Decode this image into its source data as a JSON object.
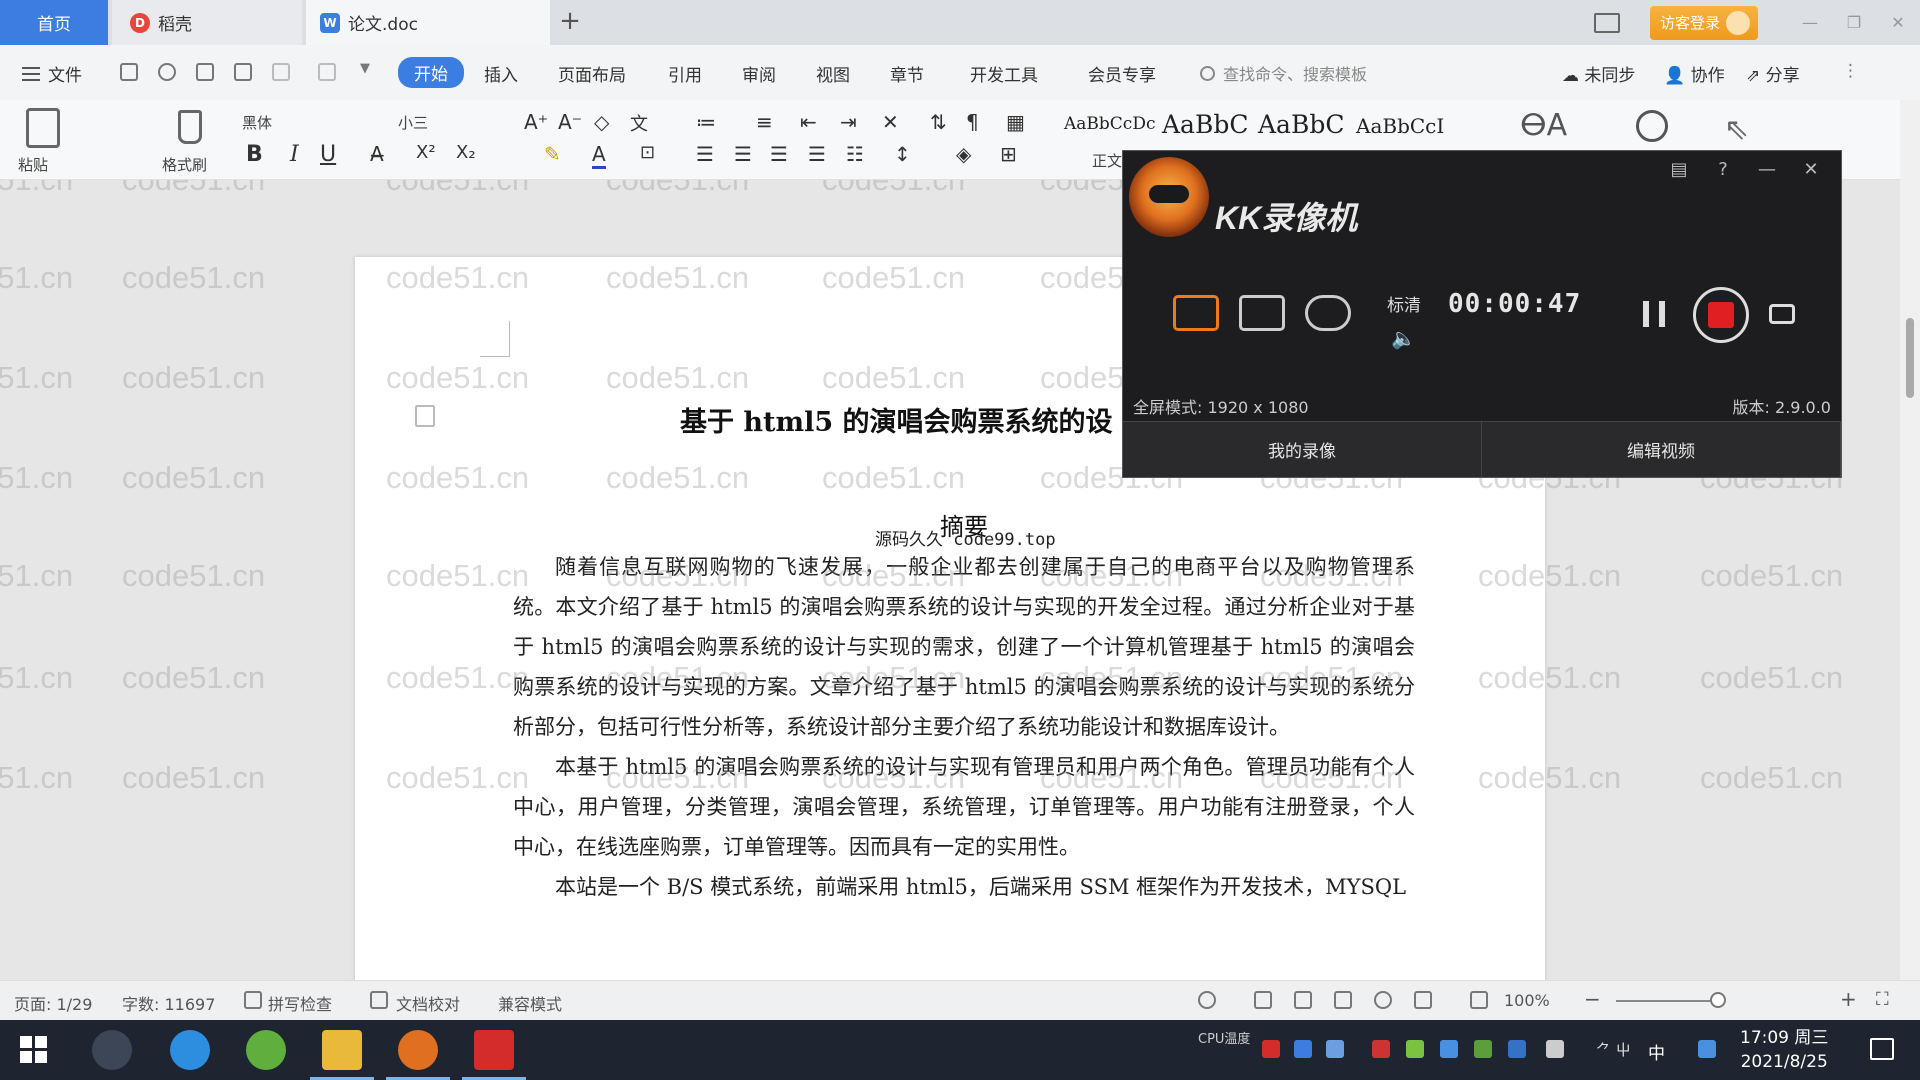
{
  "tabs": {
    "home": "首页",
    "daoke": "稻壳",
    "doc": "论文.doc",
    "add": "+"
  },
  "topright": {
    "login": "访客登录"
  },
  "menu": {
    "file": "文件",
    "items": [
      "开始",
      "插入",
      "页面布局",
      "引用",
      "审阅",
      "视图",
      "章节",
      "开发工具",
      "会员专享"
    ],
    "search": "查找命令、搜索模板",
    "sync": "未同步",
    "collab": "协作",
    "share": "分享"
  },
  "ribbon": {
    "paste": "粘贴",
    "brush": "格式刷",
    "font": "黑体",
    "size": "小三",
    "style_previews": [
      "AaBbCcDc",
      "AaBbC",
      "AaBbC",
      "AaBbCcI"
    ],
    "style_label": "正文",
    "bold": "B",
    "italic": "I",
    "underline": "U"
  },
  "document": {
    "title": "基于 html5 的演唱会购票系统的设",
    "abstract_heading": "摘要",
    "source_note": "源码久久 code99.top",
    "paragraphs": [
      "随着信息互联网购物的飞速发展，一般企业都去创建属于自己的电商平台以及购物管理系统。本文介绍了基于 html5 的演唱会购票系统的设计与实现的开发全过程。通过分析企业对于基于 html5 的演唱会购票系统的设计与实现的需求，创建了一个计算机管理基于 html5 的演唱会购票系统的设计与实现的方案。文章介绍了基于 html5 的演唱会购票系统的设计与实现的系统分析部分，包括可行性分析等，系统设计部分主要介绍了系统功能设计和数据库设计。",
      "本基于 html5 的演唱会购票系统的设计与实现有管理员和用户两个角色。管理员功能有个人中心，用户管理，分类管理，演唱会管理，系统管理，订单管理等。用户功能有注册登录，个人中心，在线选座购票，订单管理等。因而具有一定的实用性。",
      "本站是一个 B/S 模式系统，前端采用 html5，后端采用 SSM 框架作为开发技术，MYSQL"
    ],
    "watermark": "code51.cn"
  },
  "recorder": {
    "title": "KK录像机",
    "quality": "标清",
    "time": "00:00:47",
    "mode_info": "全屏模式: 1920 x 1080",
    "version": "版本: 2.9.0.0",
    "tabs": [
      "我的录像",
      "编辑视频"
    ],
    "state_color": "#e02020"
  },
  "status": {
    "page": "页面: 1/29",
    "words": "字数: 11697",
    "spell": "拼写检查",
    "proof": "文档校对",
    "compat": "兼容模式",
    "zoom": "100%"
  },
  "taskbar": {
    "time": "17:09 周三",
    "date": "2021/8/25",
    "input_method": "中",
    "tray_temp": "CPU温度"
  },
  "colors": {
    "accent": "#3b7de0",
    "login": "#ef9a1c"
  }
}
